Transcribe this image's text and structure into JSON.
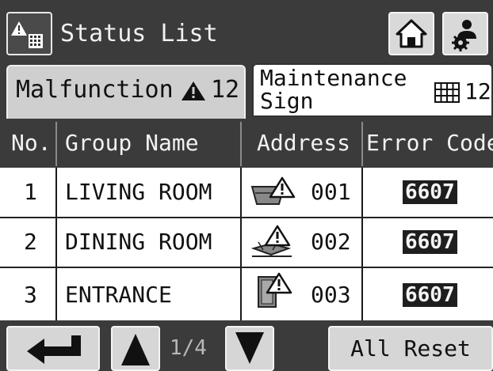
{
  "header": {
    "title": "Status List",
    "status_icon": "malfunction-status-icon",
    "home_icon": "home-icon",
    "settings_icon": "user-settings-icon"
  },
  "tabs": [
    {
      "label": "Malfunction",
      "count": "12",
      "icon": "warning-triangle-icon",
      "active": true
    },
    {
      "label": "Maintenance Sign",
      "count": "12",
      "icon": "grid-icon",
      "active": false
    }
  ],
  "table": {
    "columns": [
      "No.",
      "Group Name",
      "Address",
      "Error Code"
    ],
    "rows": [
      {
        "no": "1",
        "group": "LIVING ROOM",
        "icon": "ceiling-unit-warning-icon",
        "address": "001",
        "error": "6607"
      },
      {
        "no": "2",
        "group": "DINING ROOM",
        "icon": "floor-unit-warning-icon",
        "address": "002",
        "error": "6607"
      },
      {
        "no": "3",
        "group": "ENTRANCE",
        "icon": "wall-unit-warning-icon",
        "address": "003",
        "error": "6607"
      }
    ]
  },
  "footer": {
    "back_icon": "return-arrow-icon",
    "up_icon": "arrow-up-icon",
    "down_icon": "arrow-down-icon",
    "page": "1/4",
    "reset_label": "All Reset"
  },
  "colors": {
    "header_bg": "#3b3b3b",
    "active_tab": "#cfcfcf",
    "error_badge": "#1e1e1e",
    "button": "#d6d6d6"
  }
}
